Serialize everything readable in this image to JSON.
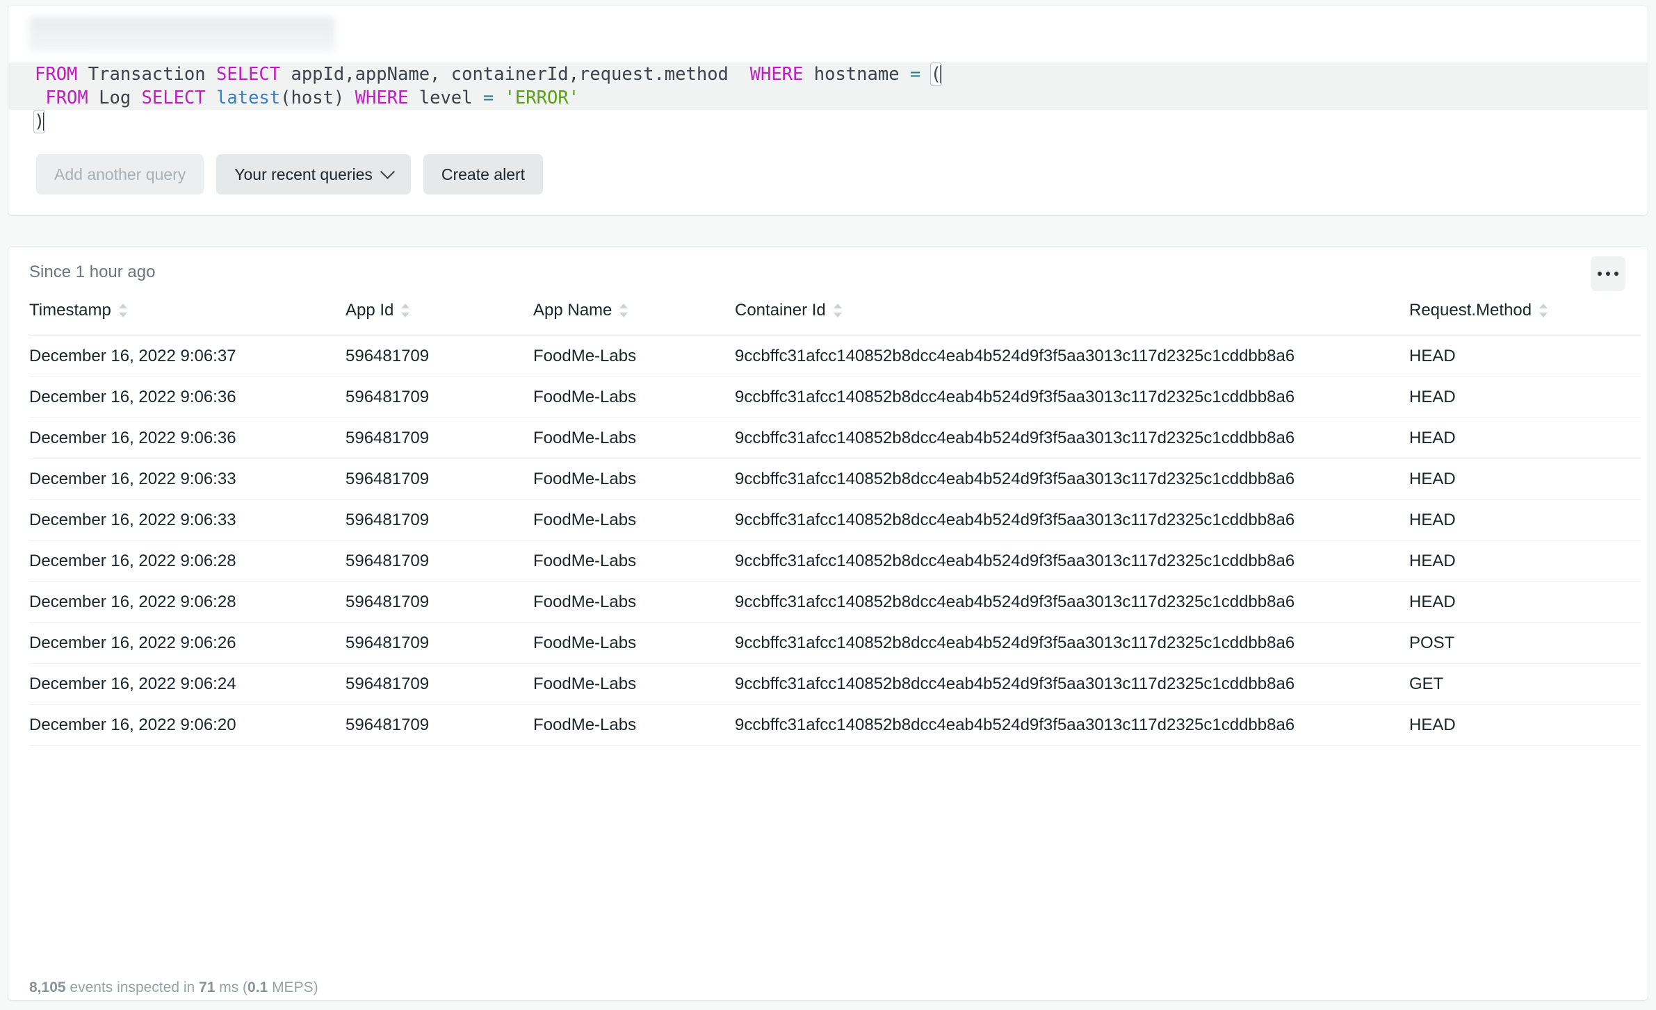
{
  "query_editor": {
    "redacted_tab_label": "",
    "lines": [
      [
        {
          "t": "FROM ",
          "c": "kw"
        },
        {
          "t": "Transaction ",
          "c": "plain"
        },
        {
          "t": "SELECT ",
          "c": "kw"
        },
        {
          "t": "appId,appName, containerId,request.method  ",
          "c": "plain"
        },
        {
          "t": "WHERE ",
          "c": "kw"
        },
        {
          "t": "hostname ",
          "c": "plain"
        },
        {
          "t": "= ",
          "c": "op"
        },
        {
          "t": "(",
          "c": "brk"
        }
      ],
      [
        {
          "t": " FROM ",
          "c": "kw"
        },
        {
          "t": "Log ",
          "c": "plain"
        },
        {
          "t": "SELECT ",
          "c": "kw"
        },
        {
          "t": "latest",
          "c": "fn"
        },
        {
          "t": "(host) ",
          "c": "plain"
        },
        {
          "t": "WHERE ",
          "c": "kw"
        },
        {
          "t": "level ",
          "c": "plain"
        },
        {
          "t": "= ",
          "c": "op"
        },
        {
          "t": "'ERROR'",
          "c": "str"
        }
      ],
      [
        {
          "t": ")",
          "c": "brk"
        }
      ]
    ]
  },
  "actions": {
    "add_another_query": "Add another query",
    "your_recent_queries": "Your recent queries",
    "create_alert": "Create alert"
  },
  "results": {
    "time_range": "Since 1 hour ago",
    "more_menu": "…",
    "columns": [
      {
        "label": "Timestamp",
        "key": "timestamp"
      },
      {
        "label": "App Id",
        "key": "app_id"
      },
      {
        "label": "App Name",
        "key": "app_name"
      },
      {
        "label": "Container Id",
        "key": "container_id"
      },
      {
        "label": "Request.Method",
        "key": "request_method"
      }
    ],
    "rows": [
      {
        "timestamp": "December 16, 2022 9:06:37",
        "app_id": "596481709",
        "app_name": "FoodMe-Labs",
        "container_id": "9ccbffc31afcc140852b8dcc4eab4b524d9f3f5aa3013c117d2325c1cddbb8a6",
        "request_method": "HEAD"
      },
      {
        "timestamp": "December 16, 2022 9:06:36",
        "app_id": "596481709",
        "app_name": "FoodMe-Labs",
        "container_id": "9ccbffc31afcc140852b8dcc4eab4b524d9f3f5aa3013c117d2325c1cddbb8a6",
        "request_method": "HEAD"
      },
      {
        "timestamp": "December 16, 2022 9:06:36",
        "app_id": "596481709",
        "app_name": "FoodMe-Labs",
        "container_id": "9ccbffc31afcc140852b8dcc4eab4b524d9f3f5aa3013c117d2325c1cddbb8a6",
        "request_method": "HEAD"
      },
      {
        "timestamp": "December 16, 2022 9:06:33",
        "app_id": "596481709",
        "app_name": "FoodMe-Labs",
        "container_id": "9ccbffc31afcc140852b8dcc4eab4b524d9f3f5aa3013c117d2325c1cddbb8a6",
        "request_method": "HEAD"
      },
      {
        "timestamp": "December 16, 2022 9:06:33",
        "app_id": "596481709",
        "app_name": "FoodMe-Labs",
        "container_id": "9ccbffc31afcc140852b8dcc4eab4b524d9f3f5aa3013c117d2325c1cddbb8a6",
        "request_method": "HEAD"
      },
      {
        "timestamp": "December 16, 2022 9:06:28",
        "app_id": "596481709",
        "app_name": "FoodMe-Labs",
        "container_id": "9ccbffc31afcc140852b8dcc4eab4b524d9f3f5aa3013c117d2325c1cddbb8a6",
        "request_method": "HEAD"
      },
      {
        "timestamp": "December 16, 2022 9:06:28",
        "app_id": "596481709",
        "app_name": "FoodMe-Labs",
        "container_id": "9ccbffc31afcc140852b8dcc4eab4b524d9f3f5aa3013c117d2325c1cddbb8a6",
        "request_method": "HEAD"
      },
      {
        "timestamp": "December 16, 2022 9:06:26",
        "app_id": "596481709",
        "app_name": "FoodMe-Labs",
        "container_id": "9ccbffc31afcc140852b8dcc4eab4b524d9f3f5aa3013c117d2325c1cddbb8a6",
        "request_method": "POST"
      },
      {
        "timestamp": "December 16, 2022 9:06:24",
        "app_id": "596481709",
        "app_name": "FoodMe-Labs",
        "container_id": "9ccbffc31afcc140852b8dcc4eab4b524d9f3f5aa3013c117d2325c1cddbb8a6",
        "request_method": "GET"
      },
      {
        "timestamp": "December 16, 2022 9:06:20",
        "app_id": "596481709",
        "app_name": "FoodMe-Labs",
        "container_id": "9ccbffc31afcc140852b8dcc4eab4b524d9f3f5aa3013c117d2325c1cddbb8a6",
        "request_method": "HEAD"
      }
    ]
  },
  "footer": {
    "events_count": "8,105",
    "events_text": " events inspected in ",
    "duration": "71",
    "duration_unit": " ms (",
    "meps": "0.1",
    "meps_unit": " MEPS)"
  },
  "colors": {
    "keyword": "#c01cc0",
    "function": "#3a7ec0",
    "string": "#5a9e18",
    "operator": "#2d7a82",
    "text": "#1d252c",
    "muted": "#6c757d",
    "page_bg": "#f7f8f8",
    "card_bg": "#ffffff",
    "editor_highlight": "#f1f3f3"
  }
}
